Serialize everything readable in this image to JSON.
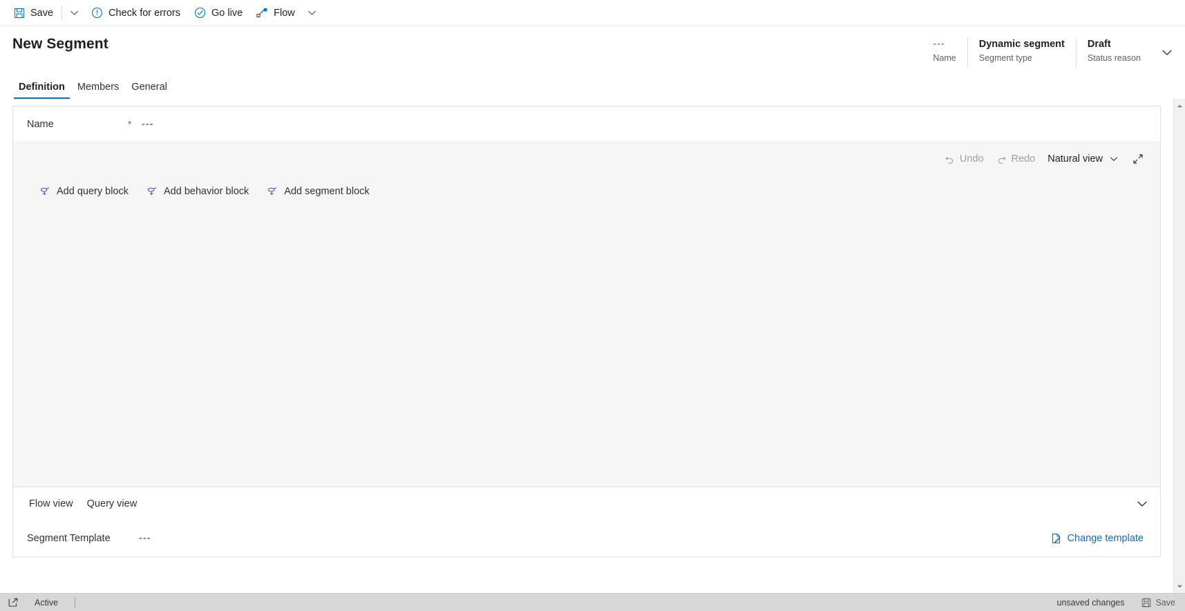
{
  "commandbar": {
    "items": [
      {
        "label": "Save",
        "icon": "save-icon"
      },
      {
        "label": "Check for errors",
        "icon": "error-circle-icon"
      },
      {
        "label": "Go live",
        "icon": "check-circle-icon"
      },
      {
        "label": "Flow",
        "icon": "flow-icon"
      }
    ]
  },
  "header": {
    "title": "New Segment",
    "fields": [
      {
        "value": "---",
        "label": "Name",
        "dim": true
      },
      {
        "value": "Dynamic segment",
        "label": "Segment type",
        "dim": false
      },
      {
        "value": "Draft",
        "label": "Status reason",
        "dim": false
      }
    ]
  },
  "tabs": [
    {
      "label": "Definition",
      "active": true
    },
    {
      "label": "Members",
      "active": false
    },
    {
      "label": "General",
      "active": false
    }
  ],
  "name_field": {
    "label": "Name",
    "required_marker": "*",
    "value": "---"
  },
  "canvas_toolbar": {
    "undo_label": "Undo",
    "redo_label": "Redo",
    "view_label": "Natural view",
    "expand_icon": "expand-icon"
  },
  "add_blocks": [
    {
      "label": "Add query block",
      "icon": "add-query-icon"
    },
    {
      "label": "Add behavior block",
      "icon": "add-behavior-icon"
    },
    {
      "label": "Add segment block",
      "icon": "add-segment-icon"
    }
  ],
  "flow_section": {
    "tabs": [
      {
        "label": "Flow view"
      },
      {
        "label": "Query view"
      }
    ],
    "collapse_icon": "chevron-down-icon",
    "template_label": "Segment Template",
    "template_value": "---",
    "change_template_label": "Change template",
    "change_template_icon": "edit-page-icon"
  },
  "statusbar": {
    "left_icon": "popout-icon",
    "state_text": "Active",
    "unsaved_text": "unsaved changes",
    "save_label": "Save",
    "save_icon": "save-icon"
  },
  "colors": {
    "accent": "#0f6cbd",
    "link": "#0078d4",
    "required": "#c4314b",
    "canvas_bg": "#f6f6f6",
    "statusbar_bg": "#d7d7d7"
  }
}
